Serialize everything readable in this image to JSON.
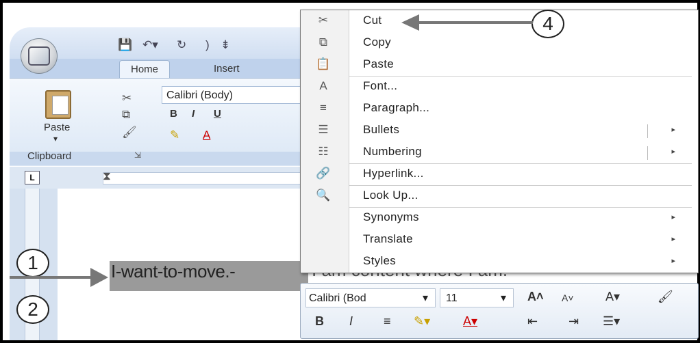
{
  "ribbon": {
    "tabs": [
      "Home",
      "Insert"
    ],
    "paste_label": "Paste",
    "clipboard_label": "Clipboard",
    "font_name": "Calibri (Body)",
    "bold": "B",
    "italic": "I",
    "underline": "U"
  },
  "document": {
    "selected_text": "I-want-to-move.-",
    "following_text": "I am content where I am."
  },
  "callouts": {
    "step1": "1",
    "step2": "2",
    "step4": "4"
  },
  "context_menu": {
    "items": [
      {
        "label": "Cut",
        "icon": "scissors-icon",
        "glyph": "✂",
        "submenu": false
      },
      {
        "label": "Copy",
        "icon": "copy-icon",
        "glyph": "⧉",
        "submenu": false
      },
      {
        "label": "Paste",
        "icon": "paste-icon",
        "glyph": "📋",
        "submenu": false
      },
      {
        "label": "Font...",
        "icon": "font-icon",
        "glyph": "A",
        "submenu": false
      },
      {
        "label": "Paragraph...",
        "icon": "paragraph-icon",
        "glyph": "≡",
        "submenu": false
      },
      {
        "label": "Bullets",
        "icon": "bullets-icon",
        "glyph": "☰",
        "submenu": true
      },
      {
        "label": "Numbering",
        "icon": "numbering-icon",
        "glyph": "☷",
        "submenu": true
      },
      {
        "label": "Hyperlink...",
        "icon": "hyperlink-icon",
        "glyph": "🔗",
        "submenu": false
      },
      {
        "label": "Look Up...",
        "icon": "lookup-icon",
        "glyph": "🔍",
        "submenu": false
      },
      {
        "label": "Synonyms",
        "icon": "",
        "glyph": "",
        "submenu": true
      },
      {
        "label": "Translate",
        "icon": "",
        "glyph": "",
        "submenu": true
      },
      {
        "label": "Styles",
        "icon": "",
        "glyph": "",
        "submenu": true
      }
    ],
    "submenu_arrow": "▸"
  },
  "mini_toolbar": {
    "font_name": "Calibri (Bod",
    "font_size": "11",
    "dropdown": "▾"
  }
}
